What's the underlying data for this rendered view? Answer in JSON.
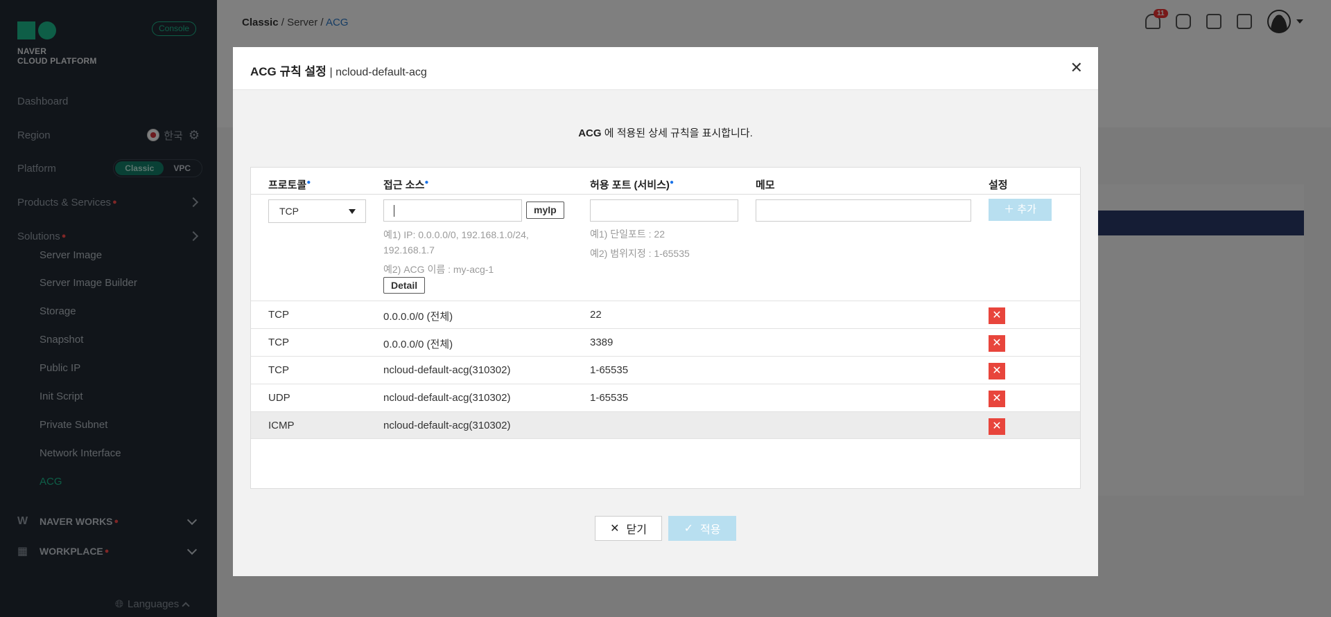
{
  "sidebar": {
    "logo_line1": "NAVER",
    "logo_line2": "CLOUD PLATFORM",
    "console_label": "Console",
    "dashboard": "Dashboard",
    "region_label": "Region",
    "region_value": "한국",
    "platform_label": "Platform",
    "platform_options": [
      "Classic",
      "VPC"
    ],
    "platform_selected": "Classic",
    "products_label": "Products & Services",
    "solutions_label": "Solutions",
    "sub_items": [
      "Server Image",
      "Server Image Builder",
      "Storage",
      "Snapshot",
      "Public IP",
      "Init Script",
      "Private Subnet",
      "Network Interface",
      "ACG"
    ],
    "active_item": "ACG",
    "naver_works": "NAVER WORKS",
    "workplace": "WORKPLACE",
    "languages": "Languages"
  },
  "topbar": {
    "breadcrumb": [
      "Classic",
      "Server",
      "ACG"
    ],
    "separator": "/",
    "notification_count": "11"
  },
  "modal": {
    "title": "ACG 규칙 설정",
    "subtitle": "| ncloud-default-acg",
    "description_bold": "ACG",
    "description_rest": " 에 적용된 상세 규칙을 표시합니다.",
    "columns": {
      "protocol": "프로토콜",
      "source": "접근 소스",
      "port": "허용 포트 (서비스)",
      "memo": "메모",
      "settings": "설정"
    },
    "form": {
      "protocol_value": "TCP",
      "myip_label": "myIp",
      "add_label": "추가",
      "source_hint1": "예1) IP: 0.0.0.0/0, 192.168.1.0/24,",
      "source_hint2": "192.168.1.7",
      "source_hint3": "예2) ACG 이름 : my-acg-1",
      "detail_label": "Detail",
      "port_hint1": "예1) 단일포트 : 22",
      "port_hint2": "예2) 범위지정 : 1-65535"
    },
    "rows": [
      {
        "protocol": "TCP",
        "source": "0.0.0.0/0 (전체)",
        "port": "22",
        "memo": ""
      },
      {
        "protocol": "TCP",
        "source": "0.0.0.0/0 (전체)",
        "port": "3389",
        "memo": ""
      },
      {
        "protocol": "TCP",
        "source": "ncloud-default-acg(310302)",
        "port": "1-65535",
        "memo": ""
      },
      {
        "protocol": "UDP",
        "source": "ncloud-default-acg(310302)",
        "port": "1-65535",
        "memo": ""
      },
      {
        "protocol": "ICMP",
        "source": "ncloud-default-acg(310302)",
        "port": "",
        "memo": ""
      }
    ],
    "close_label": "닫기",
    "apply_label": "적용"
  },
  "colors": {
    "sidebar_bg": "#222b35",
    "accent_green": "#1dbc8f",
    "link_blue": "#2a79c9",
    "delete_red": "#e8453c",
    "disabled_blue": "#b8dff0"
  }
}
